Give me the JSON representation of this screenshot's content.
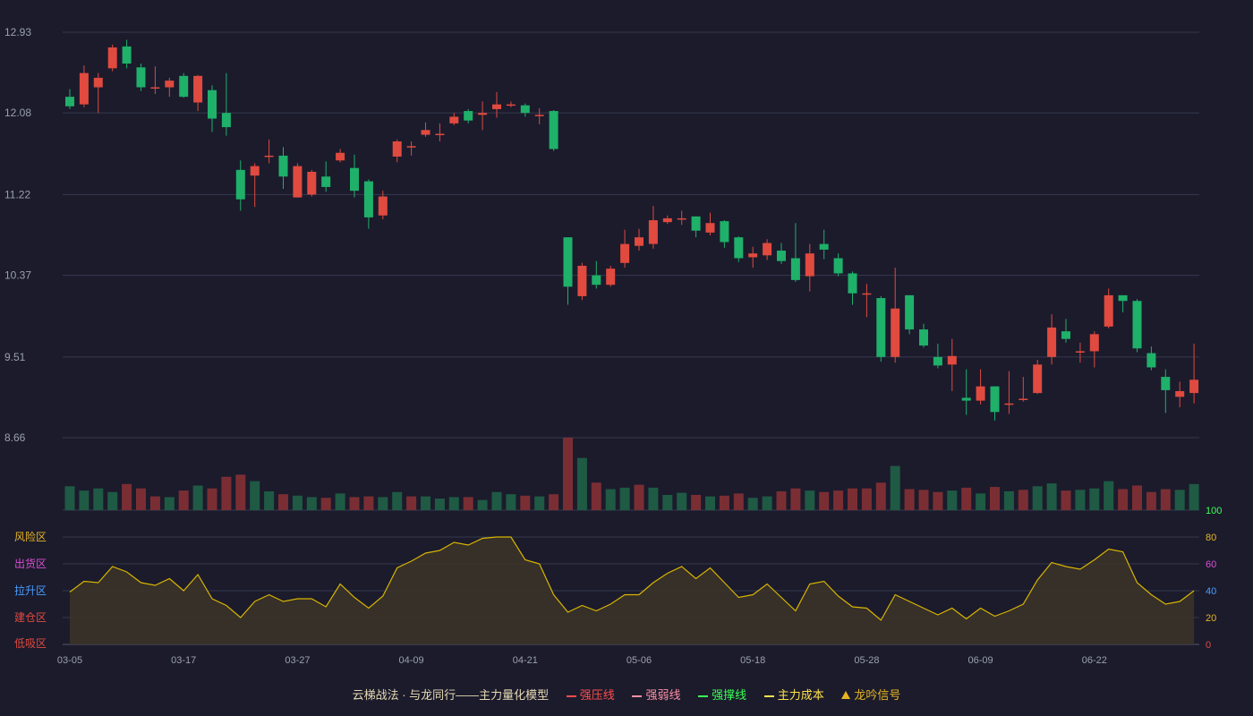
{
  "colors": {
    "up": "#e04a3f",
    "down": "#1fb06a",
    "vol_up": "#7a2e33",
    "vol_down": "#1f5a44",
    "grid": "#353a4c",
    "axis_text": "#9aa0b0",
    "model_line": "#d8b400",
    "model_fill": "#3b3428",
    "strong_pressure": "#ff4d4d",
    "weak_line": "#ff8fa3",
    "support_line": "#3dff55",
    "main_cost": "#ffe24a",
    "signal": "#e6b422"
  },
  "chart_data": {
    "type": "candlestick",
    "price_axis": {
      "ticks": [
        "12.93",
        "12.08",
        "11.22",
        "10.37",
        "9.51",
        "8.66"
      ],
      "ylim": [
        8.66,
        12.93
      ]
    },
    "x_tick_labels": [
      {
        "index": 0,
        "label": "03-05"
      },
      {
        "index": 8,
        "label": "03-17"
      },
      {
        "index": 16,
        "label": "03-27"
      },
      {
        "index": 24,
        "label": "04-09"
      },
      {
        "index": 32,
        "label": "04-21"
      },
      {
        "index": 40,
        "label": "05-06"
      },
      {
        "index": 48,
        "label": "05-18"
      },
      {
        "index": 56,
        "label": "05-28"
      },
      {
        "index": 64,
        "label": "06-09"
      },
      {
        "index": 72,
        "label": "06-22"
      }
    ],
    "candles": [
      [
        12.25,
        12.15,
        12.33,
        12.12
      ],
      [
        12.17,
        12.5,
        12.58,
        12.14
      ],
      [
        12.35,
        12.45,
        12.5,
        12.08
      ],
      [
        12.55,
        12.77,
        12.8,
        12.52
      ],
      [
        12.78,
        12.6,
        12.85,
        12.55
      ],
      [
        12.56,
        12.35,
        12.6,
        12.31
      ],
      [
        12.35,
        12.35,
        12.57,
        12.28
      ],
      [
        12.35,
        12.42,
        12.45,
        12.25
      ],
      [
        12.47,
        12.25,
        12.5,
        12.24
      ],
      [
        12.19,
        12.47,
        12.48,
        12.1
      ],
      [
        12.32,
        12.02,
        12.37,
        11.88
      ],
      [
        12.08,
        11.93,
        12.5,
        11.84
      ],
      [
        11.48,
        11.17,
        11.58,
        11.05
      ],
      [
        11.42,
        11.52,
        11.55,
        11.09
      ],
      [
        11.63,
        11.63,
        11.8,
        11.55
      ],
      [
        11.63,
        11.41,
        11.72,
        11.28
      ],
      [
        11.19,
        11.52,
        11.55,
        11.19
      ],
      [
        11.22,
        11.46,
        11.48,
        11.2
      ],
      [
        11.41,
        11.3,
        11.57,
        11.25
      ],
      [
        11.58,
        11.66,
        11.7,
        11.56
      ],
      [
        11.5,
        11.26,
        11.64,
        11.19
      ],
      [
        11.36,
        10.98,
        11.38,
        10.86
      ],
      [
        11.0,
        11.2,
        11.26,
        10.96
      ],
      [
        11.62,
        11.78,
        11.8,
        11.56
      ],
      [
        11.73,
        11.73,
        11.78,
        11.63
      ],
      [
        11.85,
        11.9,
        11.98,
        11.83
      ],
      [
        11.86,
        11.86,
        11.97,
        11.78
      ],
      [
        11.97,
        12.04,
        12.08,
        11.95
      ],
      [
        12.1,
        12.0,
        12.12,
        11.97
      ],
      [
        12.06,
        12.08,
        12.2,
        11.9
      ],
      [
        12.12,
        12.17,
        12.3,
        12.03
      ],
      [
        12.17,
        12.17,
        12.2,
        12.14
      ],
      [
        12.16,
        12.08,
        12.18,
        12.04
      ],
      [
        12.06,
        12.06,
        12.13,
        11.96
      ],
      [
        12.1,
        11.7,
        12.11,
        11.68
      ],
      [
        10.77,
        10.25,
        10.77,
        10.06
      ],
      [
        10.15,
        10.47,
        10.5,
        10.11
      ],
      [
        10.37,
        10.27,
        10.52,
        10.23
      ],
      [
        10.27,
        10.44,
        10.47,
        10.25
      ],
      [
        10.5,
        10.7,
        10.85,
        10.45
      ],
      [
        10.68,
        10.77,
        10.86,
        10.63
      ],
      [
        10.7,
        10.95,
        11.1,
        10.65
      ],
      [
        10.93,
        10.97,
        11.0,
        10.91
      ],
      [
        10.97,
        10.97,
        11.05,
        10.9
      ],
      [
        10.99,
        10.84,
        10.99,
        10.77
      ],
      [
        10.82,
        10.92,
        11.03,
        10.79
      ],
      [
        10.94,
        10.72,
        10.95,
        10.66
      ],
      [
        10.77,
        10.55,
        10.78,
        10.51
      ],
      [
        10.56,
        10.6,
        10.67,
        10.45
      ],
      [
        10.58,
        10.71,
        10.75,
        10.53
      ],
      [
        10.63,
        10.52,
        10.71,
        10.49
      ],
      [
        10.55,
        10.32,
        10.92,
        10.3
      ],
      [
        10.36,
        10.6,
        10.7,
        10.2
      ],
      [
        10.7,
        10.64,
        10.85,
        10.54
      ],
      [
        10.55,
        10.39,
        10.6,
        10.36
      ],
      [
        10.39,
        10.18,
        10.41,
        10.06
      ],
      [
        10.18,
        10.18,
        10.28,
        9.93
      ],
      [
        10.13,
        9.51,
        10.15,
        9.46
      ],
      [
        9.51,
        10.02,
        10.45,
        9.45
      ],
      [
        10.16,
        9.8,
        10.16,
        9.75
      ],
      [
        9.8,
        9.63,
        9.86,
        9.61
      ],
      [
        9.51,
        9.42,
        9.65,
        9.39
      ],
      [
        9.43,
        9.52,
        9.7,
        9.15
      ],
      [
        9.08,
        9.05,
        9.38,
        8.9
      ],
      [
        9.05,
        9.2,
        9.38,
        9.01
      ],
      [
        9.2,
        8.93,
        9.2,
        8.84
      ],
      [
        9.02,
        9.02,
        9.36,
        8.91
      ],
      [
        9.07,
        9.07,
        9.3,
        9.04
      ],
      [
        9.13,
        9.43,
        9.48,
        9.12
      ],
      [
        9.51,
        9.82,
        9.96,
        9.43
      ],
      [
        9.78,
        9.7,
        9.91,
        9.66
      ],
      [
        9.57,
        9.57,
        9.66,
        9.45
      ],
      [
        9.57,
        9.75,
        9.78,
        9.4
      ],
      [
        9.83,
        10.16,
        10.23,
        9.81
      ],
      [
        10.16,
        10.1,
        10.15,
        9.98
      ],
      [
        10.1,
        9.6,
        10.12,
        9.56
      ],
      [
        9.55,
        9.4,
        9.62,
        9.37
      ],
      [
        9.3,
        9.16,
        9.38,
        8.92
      ],
      [
        9.09,
        9.15,
        9.25,
        8.98
      ],
      [
        9.13,
        9.27,
        9.65,
        9.02
      ]
    ],
    "volume": [
      [
        33,
        "down"
      ],
      [
        27,
        "down"
      ],
      [
        30,
        "down"
      ],
      [
        25,
        "down"
      ],
      [
        36,
        "up"
      ],
      [
        30,
        "up"
      ],
      [
        19,
        "up"
      ],
      [
        18,
        "down"
      ],
      [
        27,
        "up"
      ],
      [
        34,
        "down"
      ],
      [
        30,
        "up"
      ],
      [
        46,
        "up"
      ],
      [
        49,
        "up"
      ],
      [
        40,
        "down"
      ],
      [
        26,
        "down"
      ],
      [
        22,
        "up"
      ],
      [
        20,
        "down"
      ],
      [
        18,
        "down"
      ],
      [
        17,
        "up"
      ],
      [
        23,
        "down"
      ],
      [
        18,
        "up"
      ],
      [
        19,
        "up"
      ],
      [
        18,
        "down"
      ],
      [
        25,
        "down"
      ],
      [
        19,
        "up"
      ],
      [
        19,
        "down"
      ],
      [
        16,
        "down"
      ],
      [
        18,
        "down"
      ],
      [
        18,
        "up"
      ],
      [
        14,
        "down"
      ],
      [
        25,
        "down"
      ],
      [
        22,
        "down"
      ],
      [
        20,
        "up"
      ],
      [
        19,
        "down"
      ],
      [
        22,
        "up"
      ],
      [
        100,
        "up"
      ],
      [
        72,
        "down"
      ],
      [
        38,
        "up"
      ],
      [
        29,
        "down"
      ],
      [
        31,
        "down"
      ],
      [
        35,
        "up"
      ],
      [
        31,
        "down"
      ],
      [
        21,
        "down"
      ],
      [
        24,
        "down"
      ],
      [
        21,
        "up"
      ],
      [
        19,
        "down"
      ],
      [
        20,
        "up"
      ],
      [
        23,
        "up"
      ],
      [
        17,
        "down"
      ],
      [
        19,
        "down"
      ],
      [
        26,
        "up"
      ],
      [
        30,
        "up"
      ],
      [
        27,
        "down"
      ],
      [
        25,
        "up"
      ],
      [
        27,
        "up"
      ],
      [
        30,
        "up"
      ],
      [
        30,
        "up"
      ],
      [
        38,
        "up"
      ],
      [
        61,
        "down"
      ],
      [
        29,
        "up"
      ],
      [
        28,
        "up"
      ],
      [
        25,
        "up"
      ],
      [
        27,
        "down"
      ],
      [
        31,
        "up"
      ],
      [
        23,
        "down"
      ],
      [
        32,
        "up"
      ],
      [
        26,
        "down"
      ],
      [
        28,
        "up"
      ],
      [
        33,
        "down"
      ],
      [
        37,
        "down"
      ],
      [
        27,
        "up"
      ],
      [
        28,
        "down"
      ],
      [
        30,
        "down"
      ],
      [
        40,
        "down"
      ],
      [
        29,
        "up"
      ],
      [
        34,
        "up"
      ],
      [
        25,
        "up"
      ],
      [
        29,
        "up"
      ],
      [
        28,
        "down"
      ],
      [
        36,
        "down"
      ]
    ],
    "model": {
      "name": "主力量化模型",
      "ylim": [
        0,
        100
      ],
      "y_ticks": [
        0,
        20,
        40,
        60,
        80,
        100
      ],
      "zones": [
        "风险区",
        "出货区",
        "拉升区",
        "建仓区",
        "低吸区"
      ],
      "values": [
        39,
        47,
        46,
        58,
        54,
        46,
        44,
        49,
        40,
        52,
        34,
        29,
        20,
        32,
        37,
        32,
        34,
        34,
        28,
        45,
        35,
        27,
        36,
        57,
        62,
        68,
        70,
        76,
        74,
        79,
        80,
        80,
        63,
        60,
        37,
        24,
        29,
        25,
        30,
        37,
        37,
        46,
        53,
        58,
        49,
        57,
        46,
        35,
        37,
        45,
        35,
        25,
        45,
        47,
        36,
        28,
        27,
        18,
        37,
        32,
        27,
        22,
        27,
        19,
        27,
        21,
        25,
        30,
        48,
        61,
        58,
        56,
        63,
        71,
        69,
        46,
        37,
        30,
        32,
        40
      ]
    }
  },
  "legend": {
    "title": "云梯战法 · 与龙同行——主力量化模型",
    "items": [
      {
        "label": "强压线",
        "style": "solid",
        "color_key": "strong_pressure"
      },
      {
        "label": "强弱线",
        "style": "dashed",
        "color_key": "weak_line"
      },
      {
        "label": "强撑线",
        "style": "solid",
        "color_key": "support_line"
      },
      {
        "label": "主力成本",
        "style": "dashed",
        "color_key": "main_cost"
      },
      {
        "label": "龙吟信号",
        "style": "triangle",
        "color_key": "signal"
      }
    ]
  }
}
